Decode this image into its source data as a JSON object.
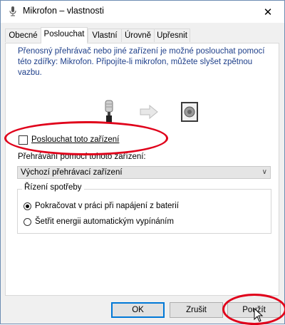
{
  "window": {
    "title": "Mikrofon – vlastnosti",
    "close_icon": "close-icon"
  },
  "tabs": [
    {
      "label": "Obecné",
      "active": false
    },
    {
      "label": "Poslouchat",
      "active": true
    },
    {
      "label": "Vlastní",
      "active": false
    },
    {
      "label": "Úrovně",
      "active": false
    },
    {
      "label": "Upřesnit",
      "active": false
    }
  ],
  "listen": {
    "description": "Přenosný přehrávač nebo jiné zařízení je možné poslouchat pomocí této zdířky: Mikrofon. Připojíte-li mikrofon, můžete slyšet zpětnou vazbu.",
    "checkbox_label": "Poslouchat toto zařízení",
    "checkbox_checked": false,
    "playback_label": "Přehrávání pomocí tohoto zařízení:",
    "playback_value": "Výchozí přehrávací zařízení"
  },
  "power": {
    "legend": "Řízení spotřeby",
    "options": [
      {
        "label": "Pokračovat v práci při napájení z baterií",
        "checked": true
      },
      {
        "label": "Šetřit energii automatickým vypínáním",
        "checked": false
      }
    ]
  },
  "buttons": {
    "ok": "OK",
    "cancel": "Zrušit",
    "apply": "Použít"
  },
  "annotation_color": "#e0001a"
}
